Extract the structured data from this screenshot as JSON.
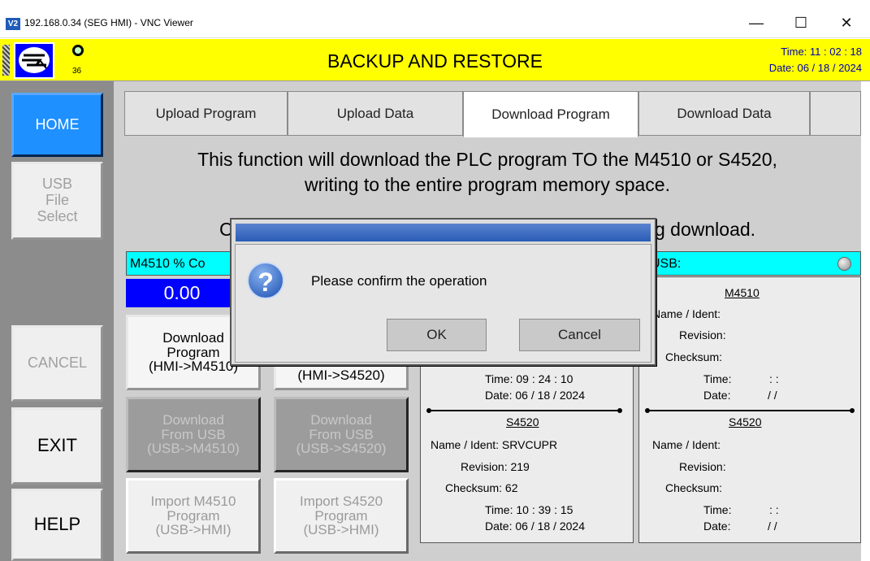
{
  "window": {
    "app_icon": "V2",
    "title": "192.168.0.34 (SEG HMI) - VNC Viewer",
    "minimize": "—",
    "maximize": "☐",
    "close": "✕"
  },
  "header": {
    "title": "BACKUP AND RESTORE",
    "status_number": "36",
    "time": "Time: 11 : 02 : 18",
    "date": "Date: 06 / 18 / 2024",
    "colors": {
      "background": "#ffff00",
      "time_text": "#0000b0"
    }
  },
  "nav": {
    "home": "HOME",
    "usb_file_select": "USB\nFile\nSelect",
    "cancel": "CANCEL",
    "exit": "EXIT",
    "help": "HELP"
  },
  "tabs": [
    {
      "label": "Upload Program",
      "active": false
    },
    {
      "label": "Upload Data",
      "active": false
    },
    {
      "label": "Download Program",
      "active": true
    },
    {
      "label": "Download Data",
      "active": false
    }
  ],
  "message": {
    "line1": "This function will download the PLC program TO the M4510 or S4520,",
    "line2": "writing to the entire program memory space.",
    "line3_left": "C",
    "line3_right": "g download."
  },
  "progress": {
    "label": "M4510 % Co",
    "value": "0.00"
  },
  "usb_status_label": "USB:",
  "buttons": {
    "download_program_m4510": "Download\nProgram\n(HMI->M4510)",
    "download_program_s4520": "(HMI->S4520)",
    "download_usb_m4510": "Download\nFrom USB\n(USB->M4510)",
    "download_usb_s4520": "Download\nFrom USB\n(USB->S4520)",
    "import_m4510": "Import M4510\nProgram\n(USB->HMI)",
    "import_s4520": "Import S4520\nProgram\n(USB->HMI)"
  },
  "hmi_panel": {
    "m4510_time": "Time:  09 : 24 : 10",
    "m4510_date": "Date:  06 / 18 / 2024",
    "s4520_title": "S4520",
    "s4520_name": "Name / Ident:  SRVCUPR",
    "s4520_revision": "Revision:  219",
    "s4520_checksum": "Checksum:   62",
    "s4520_time": "Time:  10 : 39 : 15",
    "s4520_date": "Date:  06 / 18 / 2024"
  },
  "usb_panel": {
    "m4510_title": "M4510",
    "name": "Name / Ident:",
    "revision": "Revision:",
    "checksum": "Checksum:",
    "time": "Time:",
    "time_sep": ":      :",
    "date": "Date:",
    "date_sep": "/      /",
    "s4520_title": "S4520"
  },
  "dialog": {
    "icon": "?",
    "message": "Please confirm the operation",
    "ok": "OK",
    "cancel": "Cancel"
  }
}
